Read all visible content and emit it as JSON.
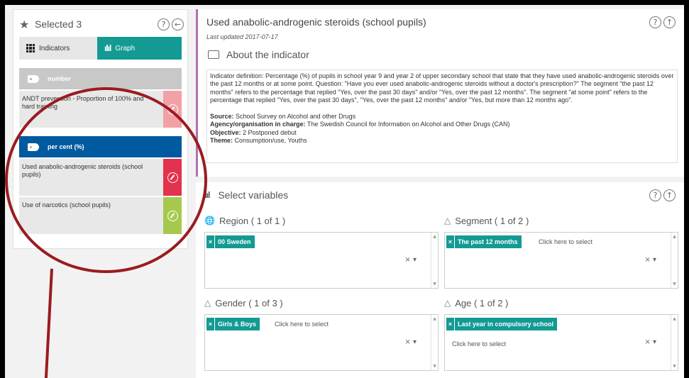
{
  "left_panel": {
    "title": "Selected 3",
    "tabs": [
      {
        "label": "Indicators"
      },
      {
        "label": "Graph"
      }
    ],
    "groups": [
      {
        "label": "number",
        "color": "#c8c8c8",
        "items": [
          {
            "label": "ANDT prevention - Proportion of 100% and hard training",
            "edit_color": "#f2a1a6"
          }
        ]
      },
      {
        "label": "per cent (%)",
        "color": "#005aa0",
        "items": [
          {
            "label": "Used anabolic-androgenic steroids (school pupils)",
            "edit_color": "#e2324d"
          },
          {
            "label": "Use of narcotics (school pupils)",
            "edit_color": "#a6c94d"
          }
        ]
      }
    ]
  },
  "info_panel": {
    "title": "Used anabolic-androgenic steroids (school pupils)",
    "updated": "Last updated 2017-07-17",
    "about_label": "About the indicator",
    "definition": "Indicator definition: Percentage (%) of pupils in school year 9 and year 2 of upper secondary school that state that they have used anabolic-androgenic steroids over the past 12 months or at some point. Question: \"Have you ever used anabolic-androgenic steroids without a doctor's prescription?\" The segment \"the past 12 months\" refers to the percentage that replied \"Yes, over the past 30 days\" and/or \"Yes, over the past 12 months\". The segment \"at some point\" refers to the percentage that replied \"Yes, over the past 30 days\", \"Yes, over the past 12 months\" and/or \"Yes, but more than 12 months ago\".",
    "rows": [
      {
        "key": "Source:",
        "value": "School Survey on Alcohol and other Drugs"
      },
      {
        "key": "Agency/organisation in charge:",
        "value": "The Swedish Council for Information on Alcohol and Other Drugs (CAN)"
      },
      {
        "key": "Objective:",
        "value": "2 Postponed debut"
      },
      {
        "key": "Theme:",
        "value": "Consumption/use, Youths"
      }
    ]
  },
  "variables_panel": {
    "title": "Select variables",
    "groups": [
      {
        "label": "Region ( 1 of 1 )",
        "chip": "00 Sweden",
        "placeholder": ""
      },
      {
        "label": "Segment ( 1 of 2 )",
        "chip": "The past 12 months",
        "placeholder": "Click here to select"
      },
      {
        "label": "Gender ( 1 of 3 )",
        "chip": "Girls & Boys",
        "placeholder": "Click here to select"
      },
      {
        "label": "Age ( 1 of 2 )",
        "chip": "Last year in compulsory school",
        "placeholder": "Click here to select"
      }
    ]
  },
  "colors": {
    "accent": "#139a93",
    "annotation": "#9a1b1f",
    "info_border": "#b46fb0"
  }
}
